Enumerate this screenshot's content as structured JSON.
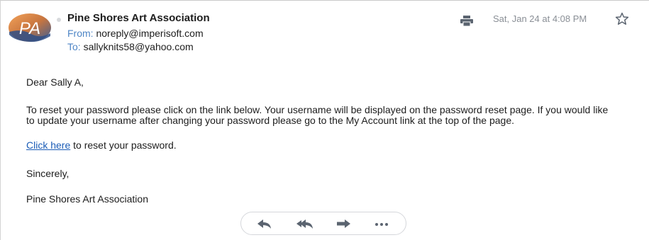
{
  "message": {
    "sender_name": "Pine Shores Art Association",
    "avatar_initials": "PA",
    "from_label": "From:",
    "from_address": "noreply@imperisoft.com",
    "to_label": "To:",
    "to_address": "sallyknits58@yahoo.com",
    "date": "Sat, Jan 24 at 4:08 PM"
  },
  "body": {
    "greeting": "Dear Sally A,",
    "paragraph": "To reset your password please click on the link below. Your username will be displayed on the password reset page. If you would like to update your username after changing your password please go to the My Account link at the top of the page.",
    "link_text": "Click here",
    "link_suffix": " to reset your password.",
    "signoff": "Sincerely,",
    "signature": "Pine Shores Art Association"
  },
  "icons": {
    "print": "print-icon",
    "star": "star-icon",
    "reply": "reply-icon",
    "reply_all": "reply-all-icon",
    "forward": "forward-icon",
    "more": "more-icon"
  },
  "colors": {
    "link": "#1c5db7",
    "meta_label": "#4f86c6",
    "muted": "#8a8f96",
    "icon": "#5b6470"
  }
}
